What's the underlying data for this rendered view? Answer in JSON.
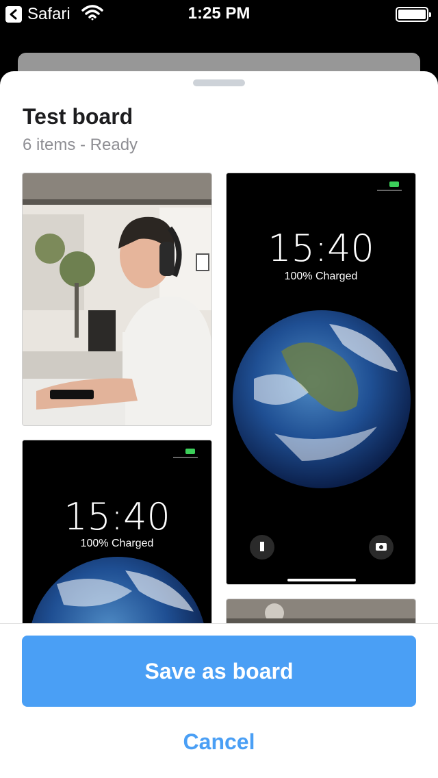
{
  "status_bar": {
    "back_app": "Safari",
    "time": "1:25 PM",
    "battery_level": 1.0
  },
  "sheet": {
    "title": "Test board",
    "subtitle": "6 items - Ready"
  },
  "items": [
    {
      "kind": "photo",
      "description_icon": "person-at-desk-photo"
    },
    {
      "kind": "lockscreen",
      "time": "15:40",
      "charged": "100% Charged"
    },
    {
      "kind": "lockscreen",
      "time": "15:40",
      "charged": "100% Charged"
    },
    {
      "kind": "photo",
      "description_icon": "office-photo"
    }
  ],
  "actions": {
    "save_label": "Save as board",
    "cancel_label": "Cancel"
  },
  "colors": {
    "accent": "#4a9ff5",
    "sheet_bg": "#ffffff",
    "subtitle": "#8e8e93"
  }
}
